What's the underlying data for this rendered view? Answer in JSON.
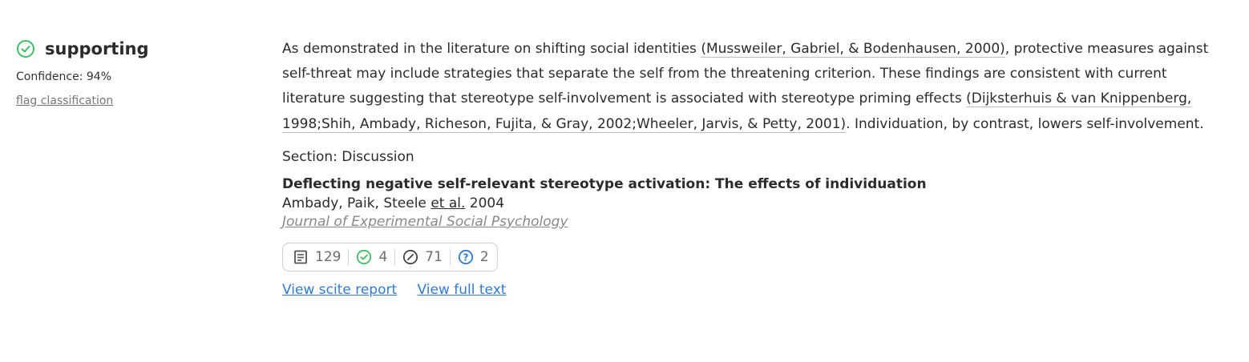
{
  "classification": {
    "label": "supporting",
    "icon": "check-circle-icon",
    "confidence_label": "Confidence: 94%",
    "flag_link": "flag classification",
    "color": "#3ebd63"
  },
  "excerpt": {
    "p1": "As demonstrated in the literature on shifting social identities ",
    "c1": "(Mussweiler, Gabriel, & Bodenhausen, 2000)",
    "p2": ", protective measures against self-threat may include strategies that separate the self from the threatening criterion. These findings are consistent with current literature suggesting that stereotype self-involvement is associated with stereotype priming effects ",
    "c2": "(Dijksterhuis & van Knippenberg, 1998;",
    "c3": "Shih, Ambady, Richeson, Fujita, & Gray, 2002;",
    "c4": "Wheeler, Jarvis, & Petty, 2001)",
    "p3": ". Individuation, by contrast, lowers self-involvement."
  },
  "section": "Section: Discussion",
  "paper": {
    "title": "Deflecting negative self-relevant stereotype activation: The effects of individuation",
    "authors": "Ambady, Paik, Steele",
    "etal": "et al.",
    "year": "2004",
    "journal": "Journal of Experimental Social Psychology"
  },
  "tally": {
    "publications": "129",
    "supporting": "4",
    "mentioning": "71",
    "contrasting": "2",
    "colors": {
      "supporting": "#3ebd63",
      "mentioning": "#555555",
      "contrasting": "#2f7bd6",
      "publications": "#555555"
    }
  },
  "links": {
    "report": "View scite report",
    "full_text": "View full text"
  }
}
